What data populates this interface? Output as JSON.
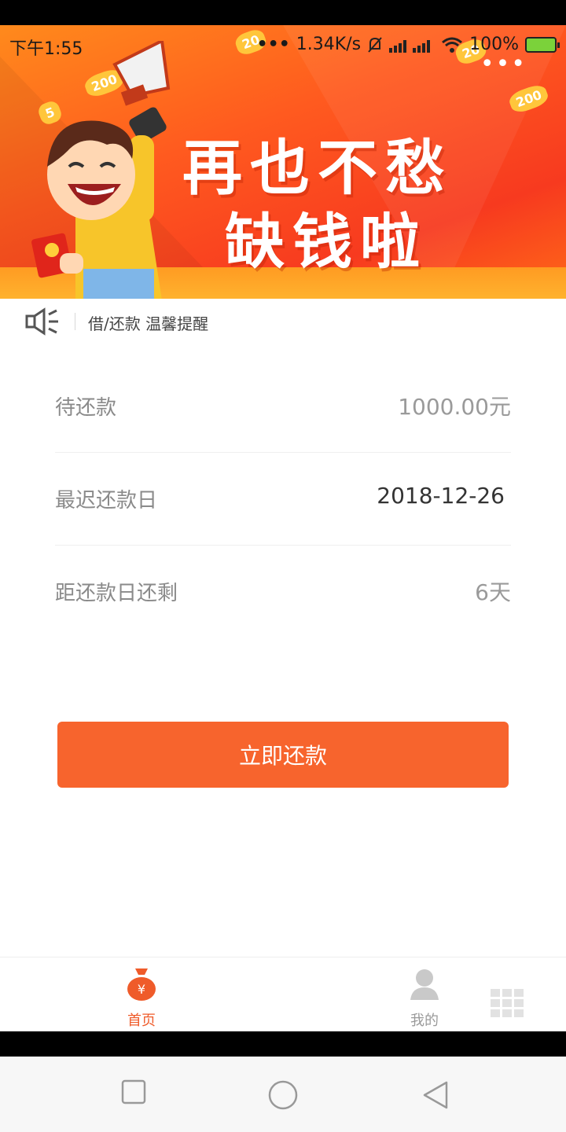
{
  "status_bar": {
    "time": "下午1:55",
    "network_speed": "1.34K/s",
    "battery": "100%"
  },
  "banner": {
    "line1": "再也不愁",
    "line2": "缺钱啦",
    "coins": [
      "200",
      "5",
      "20",
      "200",
      "20"
    ]
  },
  "notice": {
    "text": "借/还款 温馨提醒"
  },
  "loan": {
    "pending_label": "待还款",
    "pending_value": "1000.00元",
    "due_label": "最迟还款日",
    "due_value": "2018-12-26",
    "remain_label": "距还款日还剩",
    "remain_value": "6天"
  },
  "actions": {
    "repay_label": "立即还款"
  },
  "tabs": {
    "home": "首页",
    "mine": "我的"
  },
  "colors": {
    "accent": "#f7642d",
    "tab_active": "#ef5b2a"
  }
}
